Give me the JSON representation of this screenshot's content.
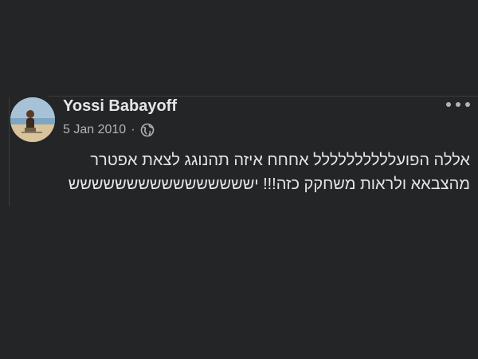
{
  "post": {
    "author": "Yossi Babayoff",
    "date": "5 Jan 2010",
    "separator": "·",
    "privacy_icon": "globe-icon",
    "more_icon": "more-options-icon",
    "text_lines": [
      "אללה הפועלללללללללל אחחח איזה תהנוגג לצאת אפטרר",
      "מהצבאא ולראות משחקק כזה!!! ישששששששששששששששש"
    ]
  },
  "colors": {
    "background": "#242526",
    "primary_text": "#e4e6eb",
    "secondary_text": "#b0b3b8"
  }
}
